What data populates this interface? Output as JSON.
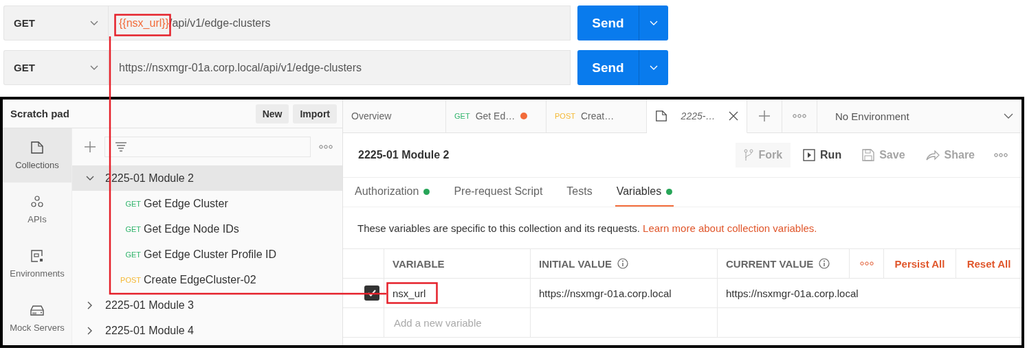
{
  "requests": [
    {
      "method": "GET",
      "url_segments": [
        {
          "text": "{{nsx_url}}",
          "kind": "variable"
        },
        {
          "text": "/api/v1/edge-clusters",
          "kind": "plain"
        }
      ],
      "send": "Send"
    },
    {
      "method": "GET",
      "url_segments": [
        {
          "text": "https://nsxmgr-01a.corp.local/api/v1/edge-clusters",
          "kind": "plain"
        }
      ],
      "send": "Send"
    }
  ],
  "sidebar": {
    "title": "Scratch pad",
    "buttons": [
      "New",
      "Import"
    ],
    "nav": [
      {
        "label": "Collections",
        "selected": true
      },
      {
        "label": "APIs",
        "selected": false
      },
      {
        "label": "Environments",
        "selected": false
      },
      {
        "label": "Mock Servers",
        "selected": false
      }
    ],
    "tree": [
      {
        "name": "2225-01 Module 2",
        "expanded": true,
        "selected": true,
        "children": [
          {
            "method": "GET",
            "color": "#2eb36a",
            "name": "Get Edge Cluster"
          },
          {
            "method": "GET",
            "color": "#2eb36a",
            "name": "Get Edge Node IDs"
          },
          {
            "method": "GET",
            "color": "#2eb36a",
            "name": "Get Edge Cluster Profile ID"
          },
          {
            "method": "POST",
            "color": "#f5b833",
            "name": "Create EdgeCluster-02"
          }
        ]
      },
      {
        "name": "2225-01 Module 3",
        "expanded": false,
        "selected": false
      },
      {
        "name": "2225-01 Module 4",
        "expanded": false,
        "selected": false
      }
    ]
  },
  "tabs": [
    {
      "kind": "plain",
      "label": "Overview",
      "selected": false
    },
    {
      "kind": "request",
      "method": "GET",
      "color": "#2eb36a",
      "label": "Get Ed…",
      "unsaved": true,
      "selected": false
    },
    {
      "kind": "request",
      "method": "POST",
      "color": "#f5b833",
      "label": "Creat…",
      "unsaved": false,
      "selected": false
    },
    {
      "kind": "collection",
      "label": "2225-…",
      "selected": true
    }
  ],
  "environment": "No Environment",
  "collection": {
    "title": "2225-01 Module 2",
    "actions": [
      {
        "label": "Fork",
        "disabled": true
      },
      {
        "label": "Run",
        "disabled": false
      },
      {
        "label": "Save",
        "disabled": true
      },
      {
        "label": "Share",
        "disabled": true
      }
    ]
  },
  "subtabs": [
    {
      "label": "Authorization",
      "dot": true,
      "selected": false
    },
    {
      "label": "Pre-request Script",
      "dot": false,
      "selected": false
    },
    {
      "label": "Tests",
      "dot": false,
      "selected": false
    },
    {
      "label": "Variables",
      "dot": true,
      "selected": true
    }
  ],
  "description": "These variables are specific to this collection and its requests.",
  "learn_more": "Learn more about collection variables.",
  "table": {
    "columns": [
      "VARIABLE",
      "INITIAL VALUE",
      "CURRENT VALUE"
    ],
    "persist_all": "Persist All",
    "reset_all": "Reset All",
    "rows": [
      {
        "checked": true,
        "variable": "nsx_url",
        "initial_value": "https://nsxmgr-01a.corp.local",
        "current_value": "https://nsxmgr-01a.corp.local"
      }
    ],
    "placeholder": "Add a new variable"
  }
}
